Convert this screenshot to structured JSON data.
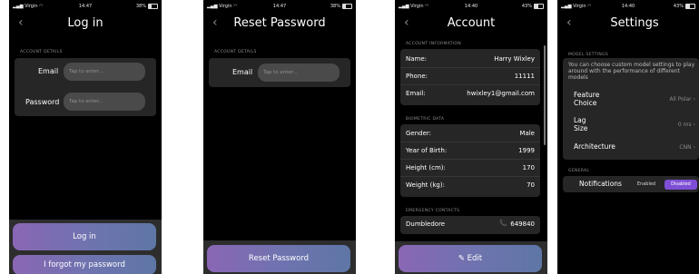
{
  "status": {
    "carrier": "Virgin",
    "s1_time": "14:47",
    "s1_batt": "38%",
    "s2_time": "14:47",
    "s2_batt": "38%",
    "s3_time": "14:40",
    "s3_batt": "43%",
    "s4_time": "14:40",
    "s4_batt": "43%"
  },
  "back_icon": "‹",
  "login": {
    "title": "Log in",
    "section": "ACCOUNT DETAILS",
    "email_label": "Email",
    "email_placeholder": "Tap to enter...",
    "password_label": "Password",
    "password_placeholder": "Tap to enter...",
    "login_button": "Log in",
    "forgot_button": "I forgot my password"
  },
  "reset": {
    "title": "Reset Password",
    "section": "ACCOUNT DETAILS",
    "email_label": "Email",
    "email_placeholder": "Tap to enter...",
    "reset_button": "Reset Password"
  },
  "account": {
    "title": "Account",
    "info_section": "ACCOUNT INFORMATION",
    "info": [
      {
        "k": "Name:",
        "v": "Harry Wixley"
      },
      {
        "k": "Phone:",
        "v": "11111"
      },
      {
        "k": "Email:",
        "v": "hwixley1@gmail.com"
      }
    ],
    "bio_section": "BIOMETRIC DATA",
    "bio": [
      {
        "k": "Gender:",
        "v": "Male"
      },
      {
        "k": "Year of Birth:",
        "v": "1999"
      },
      {
        "k": "Height (cm):",
        "v": "170"
      },
      {
        "k": "Weight (kg):",
        "v": "70"
      }
    ],
    "emergency_section": "EMERGENCY CONTACTS",
    "contact_name": "Dumbledore",
    "contact_phone": "649840",
    "edit_button": "Edit"
  },
  "settings": {
    "title": "Settings",
    "model_section": "MODEL SETTINGS",
    "model_desc": "You can choose custom model settings to play around with the performance of different models",
    "feature_label_1": "Feature",
    "feature_label_2": "Choice",
    "feature_value": "All Polar",
    "lag_label_1": "Lag",
    "lag_label_2": "Size",
    "lag_value": "0 ms",
    "arch_label": "Architecture",
    "arch_value": "CNN",
    "general_section": "GENERAL",
    "notif_label": "Notifications",
    "enabled": "Enabled",
    "disabled": "Disabled"
  },
  "colors": {
    "accent_purple": "#7e4fd6",
    "gradient_start": "#8a66b4",
    "gradient_end": "#5e76a6"
  }
}
